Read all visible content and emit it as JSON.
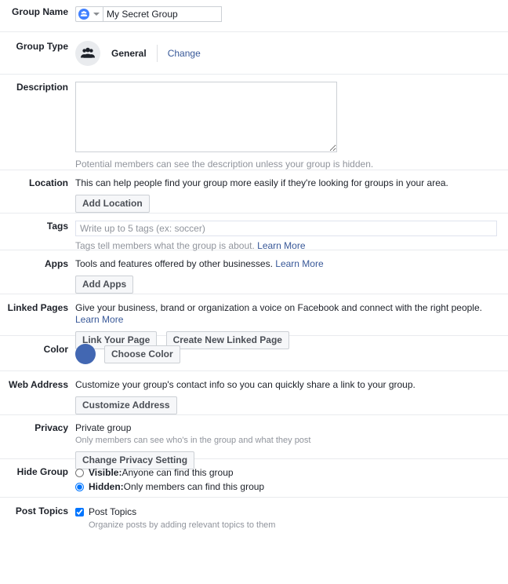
{
  "theme": {
    "link_color": "#385898",
    "text_color": "#1d2129",
    "muted_color": "#90949c",
    "divider_color": "#e9ebee",
    "button_bg": "#f6f7f9",
    "swatch_color": "#4267b2",
    "privacy_icon_color": "#4080ff"
  },
  "group_name": {
    "label": "Group Name",
    "privacy_icon": "group-members-icon",
    "dropdown_icon": "chevron-down-icon",
    "value": "My Secret Group",
    "placeholder": ""
  },
  "group_type": {
    "label": "Group Type",
    "avatar_icon": "group-people-icon",
    "type_name": "General",
    "change_link": "Change"
  },
  "description": {
    "label": "Description",
    "value": "",
    "placeholder": "",
    "help": "Potential members can see the description unless your group is hidden."
  },
  "location": {
    "label": "Location",
    "text": "This can help people find your group more easily if they're looking for groups in your area.",
    "button": "Add Location"
  },
  "tags": {
    "label": "Tags",
    "value": "",
    "placeholder": "Write up to 5 tags (ex: soccer)",
    "help": "Tags tell members what the group is about.",
    "learn_more": "Learn More"
  },
  "apps": {
    "label": "Apps",
    "text": "Tools and features offered by other businesses.",
    "learn_more": "Learn More",
    "button": "Add Apps"
  },
  "linked_pages": {
    "label": "Linked Pages",
    "text": "Give your business, brand or organization a voice on Facebook and connect with the right people.",
    "learn_more": "Learn More",
    "button_link": "Link Your Page",
    "button_create": "Create New Linked Page"
  },
  "color": {
    "label": "Color",
    "swatch": "#4267b2",
    "button": "Choose Color"
  },
  "web_address": {
    "label": "Web Address",
    "text": "Customize your group's contact info so you can quickly share a link to your group.",
    "button": "Customize Address"
  },
  "privacy": {
    "label": "Privacy",
    "current": "Private group",
    "description": "Only members can see who's in the group and what they post",
    "button": "Change Privacy Setting"
  },
  "hide_group": {
    "label": "Hide Group",
    "options": [
      {
        "id": "visible",
        "bold": "Visible:",
        "text": "Anyone can find this group",
        "selected": false
      },
      {
        "id": "hidden",
        "bold": "Hidden:",
        "text": "Only members can find this group",
        "selected": true
      }
    ]
  },
  "post_topics": {
    "label": "Post Topics",
    "checkbox_label": "Post Topics",
    "checked": true,
    "help": "Organize posts by adding relevant topics to them"
  }
}
